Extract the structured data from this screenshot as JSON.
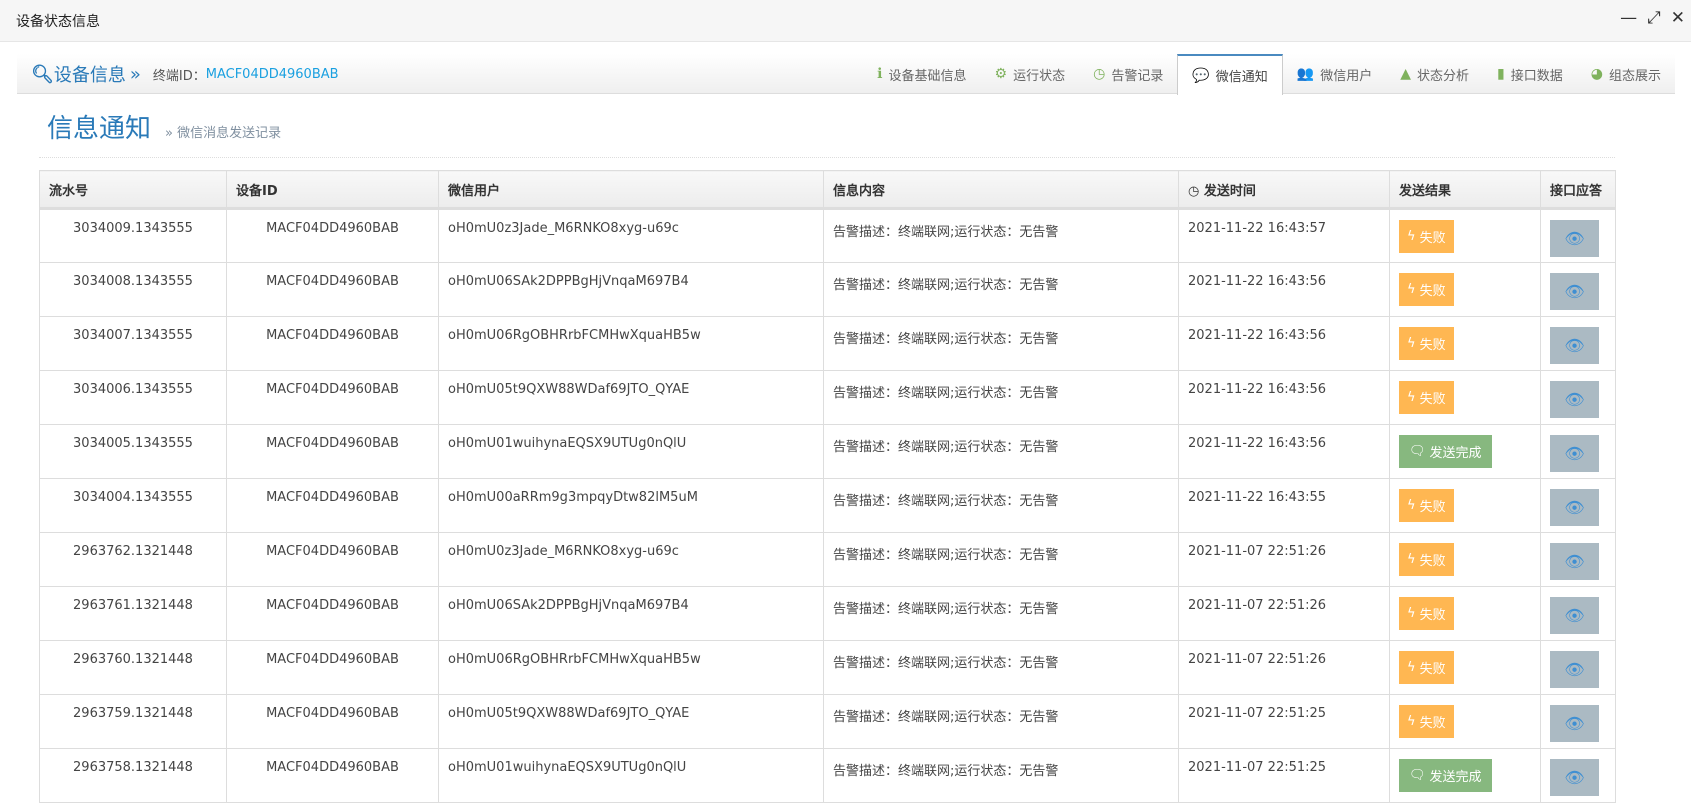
{
  "window": {
    "title": "设备状态信息",
    "minimize": "—",
    "maximize": "⤢",
    "close": "✕"
  },
  "header": {
    "title": "设备信息",
    "sep": "»",
    "terminal_label": "终端ID：",
    "terminal_id": "MACF04DD4960BAB"
  },
  "tabs": [
    {
      "label": "设备基础信息",
      "icon": "info-icon",
      "glyph": "ℹ"
    },
    {
      "label": "运行状态",
      "icon": "gears-icon",
      "glyph": "⚙"
    },
    {
      "label": "告警记录",
      "icon": "clock-icon",
      "glyph": "◷"
    },
    {
      "label": "微信通知",
      "icon": "wechat-icon",
      "glyph": "💬",
      "active": true
    },
    {
      "label": "微信用户",
      "icon": "users-icon",
      "glyph": "👥"
    },
    {
      "label": "状态分析",
      "icon": "warning-icon",
      "glyph": "▲"
    },
    {
      "label": "接口数据",
      "icon": "folder-icon",
      "glyph": "▮"
    },
    {
      "label": "组态展示",
      "icon": "dashboard-icon",
      "glyph": "◕"
    }
  ],
  "page": {
    "title": "信息通知",
    "subtitle": "» 微信消息发送记录"
  },
  "table": {
    "columns": [
      "流水号",
      "设备ID",
      "微信用户",
      "信息内容",
      "发送时间",
      "发送结果",
      "接口应答"
    ],
    "rows": [
      {
        "id": "3034009.1343555",
        "device": "MACF04DD4960BAB",
        "user": "oH0mU0z3Jade_M6RNKO8xyg-u69c",
        "content": "告警描述：终端联网;运行状态：无告警",
        "time": "2021-11-22 16:43:57",
        "result": "失败",
        "status": "fail"
      },
      {
        "id": "3034008.1343555",
        "device": "MACF04DD4960BAB",
        "user": "oH0mU06SAk2DPPBgHjVnqaM697B4",
        "content": "告警描述：终端联网;运行状态：无告警",
        "time": "2021-11-22 16:43:56",
        "result": "失败",
        "status": "fail"
      },
      {
        "id": "3034007.1343555",
        "device": "MACF04DD4960BAB",
        "user": "oH0mU06RgOBHRrbFCMHwXquaHB5w",
        "content": "告警描述：终端联网;运行状态：无告警",
        "time": "2021-11-22 16:43:56",
        "result": "失败",
        "status": "fail"
      },
      {
        "id": "3034006.1343555",
        "device": "MACF04DD4960BAB",
        "user": "oH0mU05t9QXW88WDaf69JTO_QYAE",
        "content": "告警描述：终端联网;运行状态：无告警",
        "time": "2021-11-22 16:43:56",
        "result": "失败",
        "status": "fail"
      },
      {
        "id": "3034005.1343555",
        "device": "MACF04DD4960BAB",
        "user": "oH0mU01wuihynaEQSX9UTUg0nQlU",
        "content": "告警描述：终端联网;运行状态：无告警",
        "time": "2021-11-22 16:43:56",
        "result": "发送完成",
        "status": "ok"
      },
      {
        "id": "3034004.1343555",
        "device": "MACF04DD4960BAB",
        "user": "oH0mU00aRRm9g3mpqyDtw82lM5uM",
        "content": "告警描述：终端联网;运行状态：无告警",
        "time": "2021-11-22 16:43:55",
        "result": "失败",
        "status": "fail"
      },
      {
        "id": "2963762.1321448",
        "device": "MACF04DD4960BAB",
        "user": "oH0mU0z3Jade_M6RNKO8xyg-u69c",
        "content": "告警描述：终端联网;运行状态：无告警",
        "time": "2021-11-07 22:51:26",
        "result": "失败",
        "status": "fail"
      },
      {
        "id": "2963761.1321448",
        "device": "MACF04DD4960BAB",
        "user": "oH0mU06SAk2DPPBgHjVnqaM697B4",
        "content": "告警描述：终端联网;运行状态：无告警",
        "time": "2021-11-07 22:51:26",
        "result": "失败",
        "status": "fail"
      },
      {
        "id": "2963760.1321448",
        "device": "MACF04DD4960BAB",
        "user": "oH0mU06RgOBHRrbFCMHwXquaHB5w",
        "content": "告警描述：终端联网;运行状态：无告警",
        "time": "2021-11-07 22:51:26",
        "result": "失败",
        "status": "fail"
      },
      {
        "id": "2963759.1321448",
        "device": "MACF04DD4960BAB",
        "user": "oH0mU05t9QXW88WDaf69JTO_QYAE",
        "content": "告警描述：终端联网;运行状态：无告警",
        "time": "2021-11-07 22:51:25",
        "result": "失败",
        "status": "fail"
      },
      {
        "id": "2963758.1321448",
        "device": "MACF04DD4960BAB",
        "user": "oH0mU01wuihynaEQSX9UTUg0nQlU",
        "content": "告警描述：终端联网;运行状态：无告警",
        "time": "2021-11-07 22:51:25",
        "result": "发送完成",
        "status": "ok"
      }
    ]
  }
}
